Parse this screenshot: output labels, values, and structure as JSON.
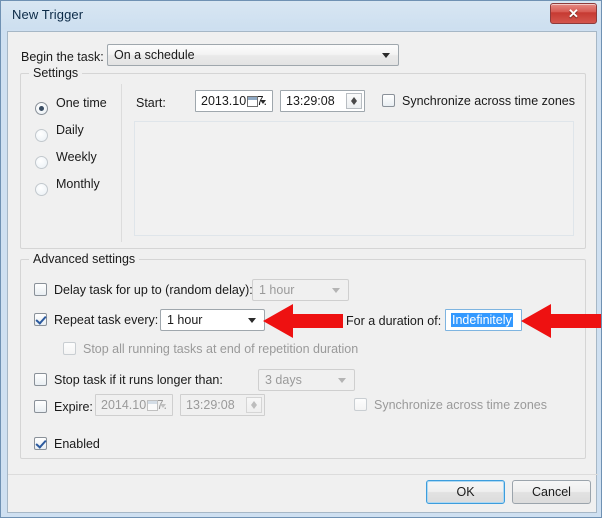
{
  "window": {
    "title": "New Trigger",
    "close_label": "✕"
  },
  "begin": {
    "label": "Begin the task:",
    "value": "On a schedule"
  },
  "settings": {
    "group_title": "Settings",
    "radios": [
      {
        "label": "One time",
        "checked": true
      },
      {
        "label": "Daily",
        "checked": false
      },
      {
        "label": "Weekly",
        "checked": false
      },
      {
        "label": "Monthly",
        "checked": false
      }
    ],
    "start_label": "Start:",
    "start_date": "2013.10.17.",
    "start_time": "13:29:08",
    "sync_label": "Synchronize across time zones",
    "sync_checked": false
  },
  "advanced": {
    "group_title": "Advanced settings",
    "delay_label": "Delay task for up to (random delay):",
    "delay_checked": false,
    "delay_value": "1 hour",
    "repeat_label": "Repeat task every:",
    "repeat_checked": true,
    "repeat_value": "1 hour",
    "duration_label": "For a duration of:",
    "duration_value": "Indefinitely",
    "stop_all_label": "Stop all running tasks at end of repetition duration",
    "stop_all_checked": false,
    "stop_if_label": "Stop task if it runs longer than:",
    "stop_if_checked": false,
    "stop_if_value": "3 days",
    "expire_label": "Expire:",
    "expire_checked": false,
    "expire_date": "2014.10.17.",
    "expire_time": "13:29:08",
    "expire_sync_label": "Synchronize across time zones",
    "expire_sync_checked": false,
    "enabled_label": "Enabled",
    "enabled_checked": true
  },
  "footer": {
    "ok_label": "OK",
    "cancel_label": "Cancel"
  },
  "annotations": {
    "arrow_color": "#ee1111",
    "arrow_repeat_name": "red-arrow-pointing-at-repeat-dropdown",
    "arrow_duration_name": "red-arrow-pointing-at-duration-field"
  }
}
